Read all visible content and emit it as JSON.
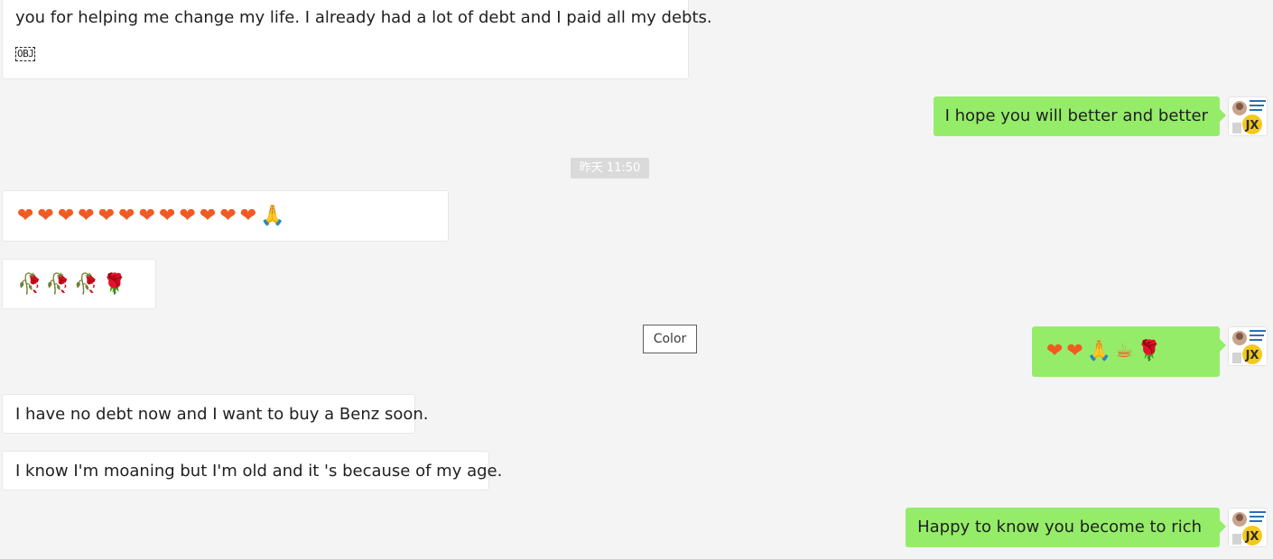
{
  "messages": {
    "m1_text": "you for helping me change my life. I already had a lot of debt and I paid all my debts.",
    "m1_obj": "OBJ",
    "m2_text": "I hope you will better and better",
    "m3_timestamp": "昨天 11:50",
    "m4_emojis": "❤❤❤❤❤❤❤❤❤❤❤❤🙏",
    "m5_emojis": "🥀🥀🥀🌹",
    "m6_emojis": "❤❤🙏☕🌹",
    "m7_text": "I have no debt now and I want to buy a Benz soon.",
    "m8_text": "I know I'm moaning but I'm old and it 's because of my age.",
    "m9_text": "Happy to know you become to rich"
  },
  "tooltip": {
    "label": "Color"
  },
  "colors": {
    "background": "#f4f4f4",
    "incoming_bubble": "#ffffff",
    "outgoing_bubble": "#95ec69",
    "timestamp_bg": "#dadada",
    "heart": "#f15a22"
  },
  "icons": {
    "avatar": "user-avatar-icon"
  }
}
